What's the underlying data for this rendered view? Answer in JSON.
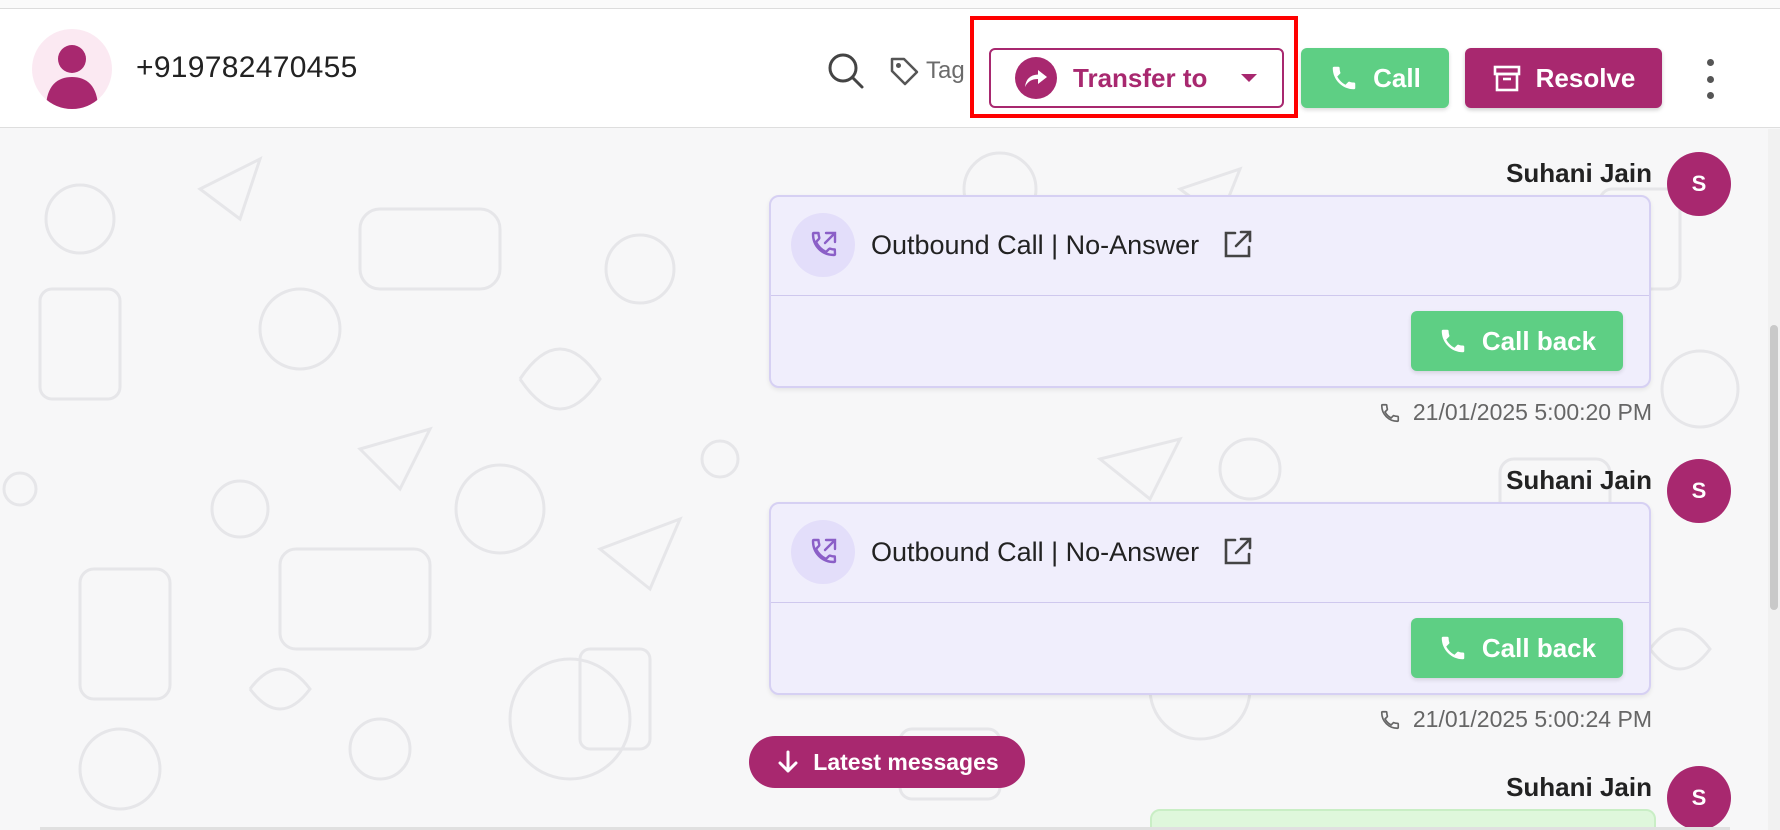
{
  "header": {
    "phone_number": "+919782470455",
    "tag_label": "Tag",
    "transfer_label": "Transfer to",
    "call_label": "Call",
    "resolve_label": "Resolve"
  },
  "messages": [
    {
      "sender": "Suhani Jain",
      "avatar_initial": "S",
      "title": "Outbound Call | No-Answer",
      "action_label": "Call back",
      "timestamp": "21/01/2025 5:00:20 PM"
    },
    {
      "sender": "Suhani Jain",
      "avatar_initial": "S",
      "title": "Outbound Call | No-Answer",
      "action_label": "Call back",
      "timestamp": "21/01/2025 5:00:24 PM"
    },
    {
      "sender": "Suhani Jain",
      "avatar_initial": "S"
    }
  ],
  "latest_label": "Latest messages",
  "colors": {
    "brand": "#a8286f",
    "call_green": "#5ecf84",
    "card_bg": "#f0eefc",
    "highlight": "#ff0000"
  },
  "icons": [
    "user-avatar-icon",
    "search-icon",
    "tag-icon",
    "share-arrow-icon",
    "chevron-down-icon",
    "phone-icon",
    "archive-icon",
    "more-vertical-icon",
    "outbound-call-icon",
    "external-link-icon",
    "arrow-down-icon"
  ]
}
